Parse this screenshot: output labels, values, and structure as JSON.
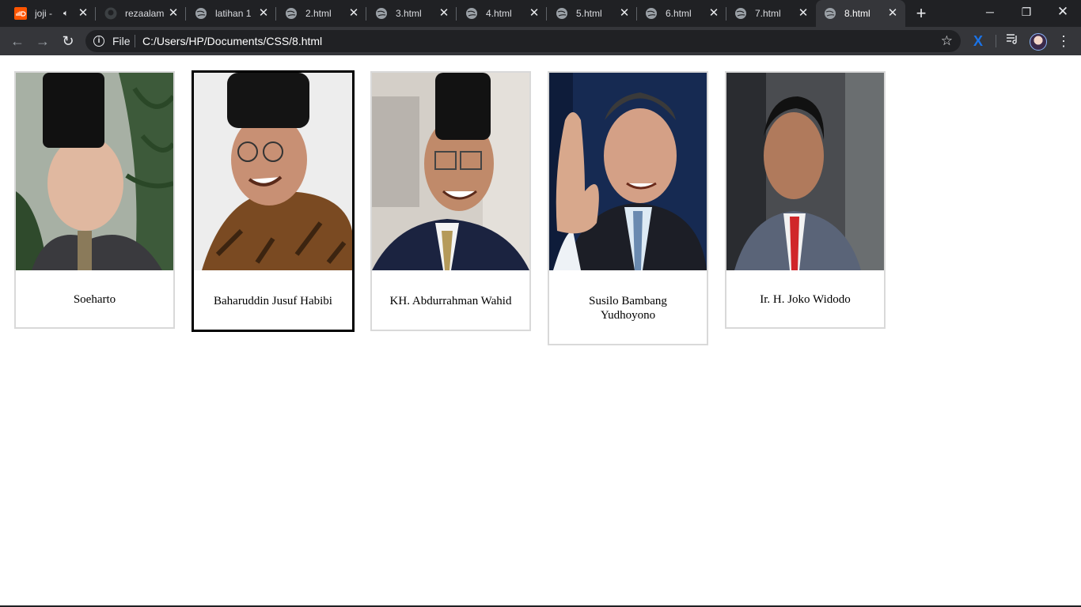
{
  "browser": {
    "tabs": [
      {
        "title": "joji -",
        "favicon": "soundcloud-icon",
        "audio": true,
        "active": false
      },
      {
        "title": "rezaalam",
        "favicon": "github-icon",
        "active": false
      },
      {
        "title": "latihan 1",
        "favicon": "globe-icon",
        "active": false
      },
      {
        "title": "2.html",
        "favicon": "globe-icon",
        "active": false
      },
      {
        "title": "3.html",
        "favicon": "globe-icon",
        "active": false
      },
      {
        "title": "4.html",
        "favicon": "globe-icon",
        "active": false
      },
      {
        "title": "5.html",
        "favicon": "globe-icon",
        "active": false
      },
      {
        "title": "6.html",
        "favicon": "globe-icon",
        "active": false
      },
      {
        "title": "7.html",
        "favicon": "globe-icon",
        "active": false
      },
      {
        "title": "8.html",
        "favicon": "globe-icon",
        "active": true
      }
    ],
    "address": {
      "scheme_label": "File",
      "url": "C:/Users/HP/Documents/CSS/8.html"
    },
    "colors": {
      "tabstrip": "#202124",
      "toolbar": "#35363a",
      "active_tab": "#35363a"
    }
  },
  "gallery": {
    "cards": [
      {
        "name": "Soeharto",
        "highlighted": false
      },
      {
        "name": "Baharuddin Jusuf Habibi",
        "highlighted": true
      },
      {
        "name": "KH. Abdurrahman Wahid",
        "highlighted": false
      },
      {
        "name": "Susilo Bambang Yudhoyono",
        "highlighted": false
      },
      {
        "name": "Ir. H. Joko Widodo",
        "highlighted": false
      }
    ]
  }
}
